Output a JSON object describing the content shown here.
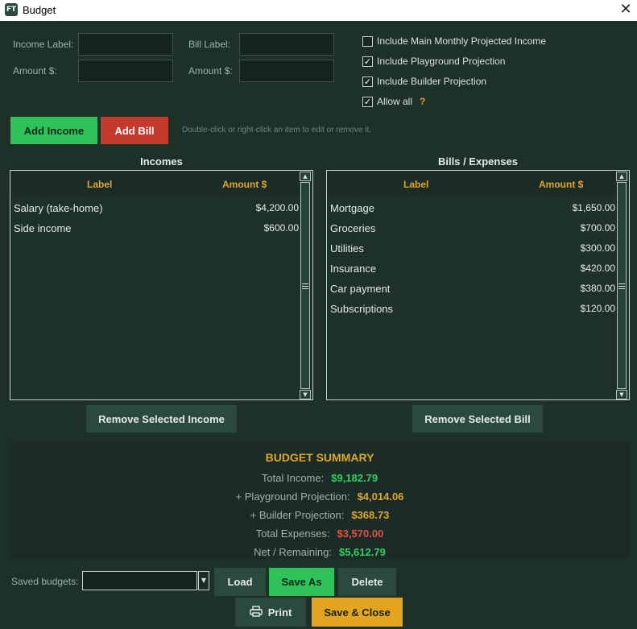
{
  "window": {
    "title": "Budget",
    "app_icon_text": "FT",
    "close_glyph": "✕"
  },
  "form": {
    "income_label_caption": "Income Label:",
    "income_amount_caption": "Amount $:",
    "bill_label_caption": "Bill Label:",
    "bill_amount_caption": "Amount $:",
    "income_label_value": "",
    "income_amount_value": "",
    "bill_label_value": "",
    "bill_amount_value": ""
  },
  "options": [
    {
      "label": "Include Main Monthly Projected Income",
      "checked": false
    },
    {
      "label": "Include Playground Projection",
      "checked": true
    },
    {
      "label": "Include Builder Projection",
      "checked": true
    },
    {
      "label": "Allow all",
      "checked": true
    }
  ],
  "help_glyph": "?",
  "check_glyph": "✓",
  "buttons": {
    "add_income": "Add Income",
    "add_bill": "Add Bill",
    "remove_income": "Remove Selected Income",
    "remove_bill": "Remove Selected Bill",
    "load": "Load",
    "save_as": "Save As",
    "delete": "Delete",
    "print": "Print",
    "save_close": "Save & Close"
  },
  "hint": "Double-click or right-click an item to edit or remove it.",
  "incomes": {
    "title": "Incomes",
    "columns": [
      "Label",
      "Amount $"
    ],
    "rows": [
      {
        "label": "Salary (take-home)",
        "amount": "$4,200.00"
      },
      {
        "label": "Side income",
        "amount": "$600.00"
      }
    ]
  },
  "bills": {
    "title": "Bills / Expenses",
    "columns": [
      "Label",
      "Amount $"
    ],
    "rows": [
      {
        "label": "Mortgage",
        "amount": "$1,650.00"
      },
      {
        "label": "Groceries",
        "amount": "$700.00"
      },
      {
        "label": "Utilities",
        "amount": "$300.00"
      },
      {
        "label": "Insurance",
        "amount": "$420.00"
      },
      {
        "label": "Car payment",
        "amount": "$380.00"
      },
      {
        "label": "Subscriptions",
        "amount": "$120.00"
      }
    ]
  },
  "summary": {
    "title": "BUDGET SUMMARY",
    "lines": [
      {
        "label": "Total Income:",
        "value": "$9,182.79",
        "color": "#33cf62"
      },
      {
        "label": "+ Playground Projection:",
        "value": "$4,014.06",
        "color": "#e0a52a"
      },
      {
        "label": "+ Builder Projection:",
        "value": "$368.73",
        "color": "#e0a52a"
      },
      {
        "label": "Total Expenses:",
        "value": "$3,570.00",
        "color": "#e0504a"
      },
      {
        "label": "Net / Remaining:",
        "value": "$5,612.79",
        "color": "#33cf62"
      }
    ]
  },
  "saved": {
    "caption": "Saved budgets:",
    "selected": ""
  },
  "icons": {
    "print": "printer-icon",
    "dropdown": "chevron-down-icon",
    "scroll_up": "arrow-up-icon",
    "scroll_down": "arrow-down-icon"
  },
  "colors": {
    "background": "#1d3129",
    "accent_gold": "#e0a52a",
    "positive": "#33cf62",
    "negative": "#e0504a",
    "add_income": "#2fc25a",
    "add_bill": "#c6392d"
  }
}
